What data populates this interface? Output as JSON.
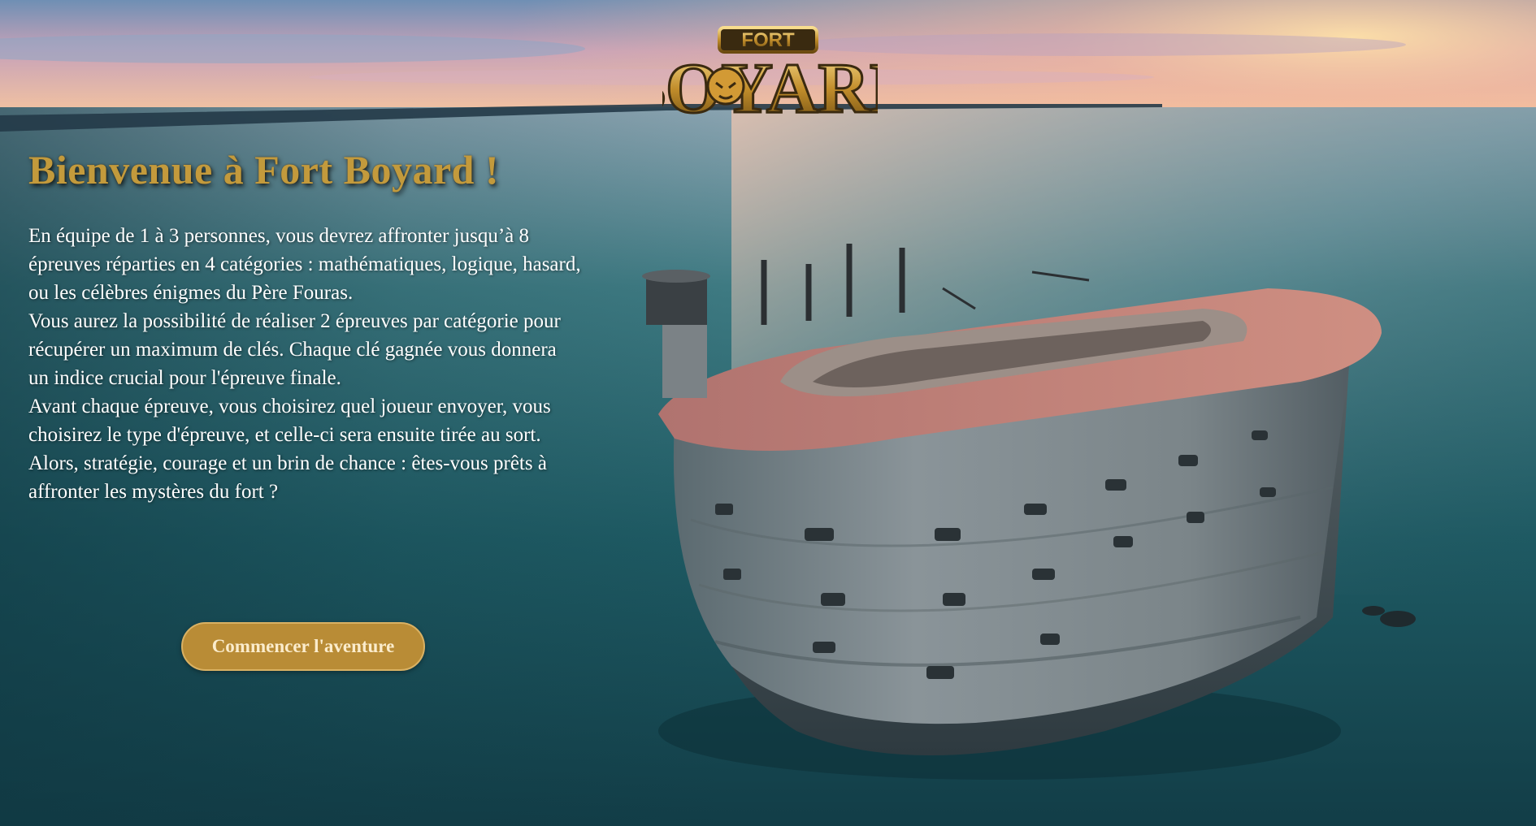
{
  "page": {
    "logo_text": "FORT BOYARD",
    "title": "Bienvenue à Fort Boyard !",
    "paragraphs": [
      "En équipe de 1 à 3 personnes, vous devrez affronter jusqu’à 8 épreuves réparties en 4 catégories : mathématiques, logique, hasard, ou les célèbres énigmes du Père Fouras.",
      "Vous aurez la possibilité de réaliser 2 épreuves par catégorie pour récupérer un maximum de clés. Chaque clé gagnée vous donnera un indice crucial pour l'épreuve finale.",
      "Avant chaque épreuve, vous choisirez quel joueur envoyer, vous choisirez le type d'épreuve, et celle-ci sera ensuite tirée au sort.",
      "Alors, stratégie, courage et un brin de chance : êtes-vous prêts à affronter les mystères du fort ?"
    ],
    "cta_label": "Commencer l'aventure"
  },
  "colors": {
    "title_gold": "#c39a3c",
    "button_gold": "#b98c36",
    "body_text": "#ffffff"
  },
  "icons": {
    "logo": "fort-boyard-logo"
  }
}
